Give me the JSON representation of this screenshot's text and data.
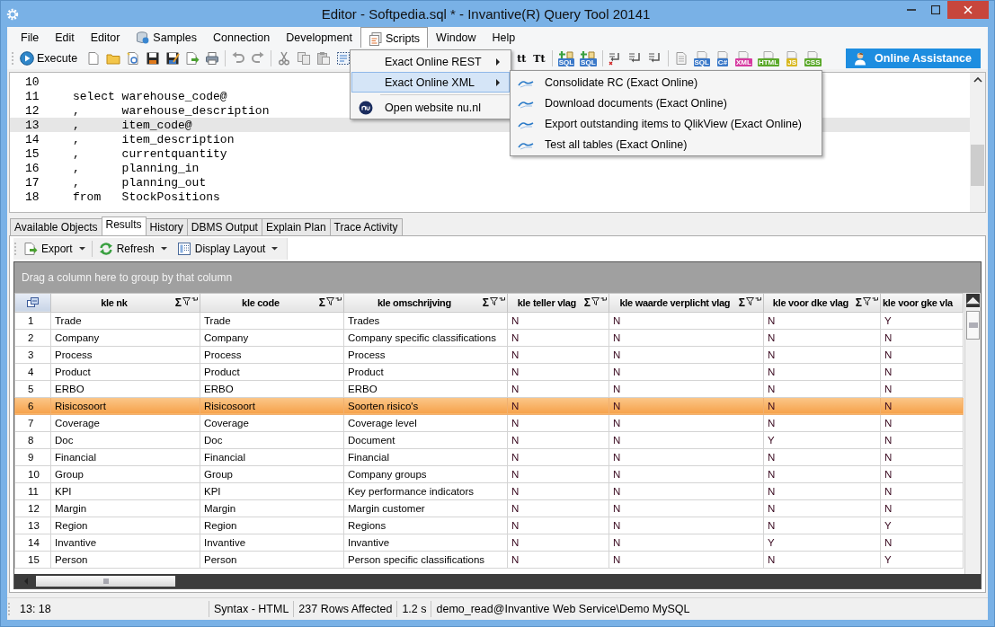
{
  "window": {
    "title": "Editor - Softpedia.sql * - Invantive(R) Query Tool 20141"
  },
  "menubar": [
    {
      "label": "File",
      "kind": "text",
      "selected": false
    },
    {
      "label": "Edit",
      "kind": "text",
      "selected": false
    },
    {
      "label": "Editor",
      "kind": "text",
      "selected": false
    },
    {
      "label": "Samples",
      "kind": "database",
      "selected": false
    },
    {
      "label": "Connection",
      "kind": "text",
      "selected": false
    },
    {
      "label": "Development",
      "kind": "text",
      "selected": false
    },
    {
      "label": "Scripts",
      "kind": "documents",
      "selected": true
    },
    {
      "label": "Window",
      "kind": "text",
      "selected": false
    },
    {
      "label": "Help",
      "kind": "text",
      "selected": false
    }
  ],
  "toolbar": {
    "execute": "Execute",
    "case_buttons": [
      "tt",
      "Tt"
    ],
    "add_script_buttons": [
      "SQL",
      "SQL"
    ],
    "file_type_buttons": [
      {
        "label": "SQL",
        "color": "#3a78c8"
      },
      {
        "label": "C#",
        "color": "#3a78c8"
      },
      {
        "label": "XML",
        "color": "#d63aa0"
      },
      {
        "label": "HTML",
        "color": "#5aa82a"
      },
      {
        "label": "JS",
        "color": "#d8b820"
      },
      {
        "label": "CSS",
        "color": "#5aa82a"
      }
    ],
    "assistance": "Online Assistance"
  },
  "scripts_menu": {
    "items": [
      {
        "label": "Exact Online REST",
        "kind": "submenu",
        "selected": false
      },
      {
        "label": "Exact Online XML",
        "kind": "submenu",
        "selected": true
      },
      {
        "label": "Open website nu.nl",
        "kind": "link",
        "selected": false
      }
    ],
    "submenu": [
      "Consolidate RC (Exact Online)",
      "Download documents (Exact Online)",
      "Export outstanding items to QlikView (Exact Online)",
      "Test all tables (Exact Online)"
    ]
  },
  "editor": {
    "lines": [
      {
        "number": "10",
        "current": false
      },
      {
        "number": "11",
        "text": "select warehouse_code@",
        "current": false
      },
      {
        "number": "12",
        "text": ",      warehouse_description",
        "current": false
      },
      {
        "number": "13",
        "text": ",      item_code@",
        "current": true
      },
      {
        "number": "14",
        "text": ",      item_description",
        "current": false
      },
      {
        "number": "15",
        "text": ",      currentquantity",
        "current": false
      },
      {
        "number": "16",
        "text": ",      planning_in",
        "current": false
      },
      {
        "number": "17",
        "text": ",      planning_out",
        "current": false
      },
      {
        "number": "18",
        "text": "from   StockPositions",
        "current": false
      }
    ]
  },
  "tabs": [
    {
      "label": "Available Objects",
      "selected": false
    },
    {
      "label": "Results",
      "selected": true
    },
    {
      "label": "History",
      "selected": false
    },
    {
      "label": "DBMS Output",
      "selected": false
    },
    {
      "label": "Explain Plan",
      "selected": false
    },
    {
      "label": "Trace Activity",
      "selected": false
    }
  ],
  "results_toolbar": [
    {
      "label": "Export",
      "kind": "export"
    },
    {
      "label": "Refresh",
      "kind": "refresh"
    },
    {
      "label": "Display Layout",
      "kind": "layout"
    }
  ],
  "group_panel": "Drag a column here to group by that column",
  "table": {
    "columns": [
      {
        "label": "kle nk",
        "sum": "Σ"
      },
      {
        "label": "kle code",
        "sum": "Σ"
      },
      {
        "label": "kle omschrijving",
        "sum": "Σ"
      },
      {
        "label": "kle teller vlag",
        "sum": "Σ"
      },
      {
        "label": "kle waarde verplicht vlag",
        "sum": "Σ"
      },
      {
        "label": "kle voor dke vlag",
        "sum": "Σ"
      },
      {
        "label": "kle voor gke vla"
      }
    ],
    "rows": [
      {
        "number": "1",
        "cells": [
          "Trade",
          "Trade",
          "Trades",
          "N",
          "N",
          "N",
          "Y"
        ],
        "selected": false
      },
      {
        "number": "2",
        "cells": [
          "Company",
          "Company",
          "Company specific classifications",
          "N",
          "N",
          "N",
          "N"
        ],
        "selected": false
      },
      {
        "number": "3",
        "cells": [
          "Process",
          "Process",
          "Process",
          "N",
          "N",
          "N",
          "N"
        ],
        "selected": false
      },
      {
        "number": "4",
        "cells": [
          "Product",
          "Product",
          "Product",
          "N",
          "N",
          "N",
          "N"
        ],
        "selected": false
      },
      {
        "number": "5",
        "cells": [
          "ERBO",
          "ERBO",
          "ERBO",
          "N",
          "N",
          "N",
          "N"
        ],
        "selected": false
      },
      {
        "number": "6",
        "cells": [
          "Risicosoort",
          "Risicosoort",
          "Soorten risico's",
          "N",
          "N",
          "N",
          "N"
        ],
        "selected": true
      },
      {
        "number": "7",
        "cells": [
          "Coverage",
          "Coverage",
          "Coverage level",
          "N",
          "N",
          "N",
          "N"
        ],
        "selected": false
      },
      {
        "number": "8",
        "cells": [
          "Doc",
          "Doc",
          "Document",
          "N",
          "N",
          "Y",
          "N"
        ],
        "selected": false
      },
      {
        "number": "9",
        "cells": [
          "Financial",
          "Financial",
          "Financial",
          "N",
          "N",
          "N",
          "N"
        ],
        "selected": false
      },
      {
        "number": "10",
        "cells": [
          "Group",
          "Group",
          "Company groups",
          "N",
          "N",
          "N",
          "N"
        ],
        "selected": false
      },
      {
        "number": "11",
        "cells": [
          "KPI",
          "KPI",
          "Key performance indicators",
          "N",
          "N",
          "N",
          "N"
        ],
        "selected": false
      },
      {
        "number": "12",
        "cells": [
          "Margin",
          "Margin",
          "Margin customer",
          "N",
          "N",
          "N",
          "N"
        ],
        "selected": false
      },
      {
        "number": "13",
        "cells": [
          "Region",
          "Region",
          "Regions",
          "N",
          "N",
          "N",
          "Y"
        ],
        "selected": false
      },
      {
        "number": "14",
        "cells": [
          "Invantive",
          "Invantive",
          "Invantive",
          "N",
          "N",
          "Y",
          "N"
        ],
        "selected": false
      },
      {
        "number": "15",
        "cells": [
          "Person",
          "Person",
          "Person specific classifications",
          "N",
          "N",
          "N",
          "Y"
        ],
        "selected": false
      }
    ]
  },
  "status_bar": [
    "13: 18",
    "Syntax - HTML",
    "237 Rows Affected",
    "1.2 s",
    "demo_read@Invantive Web Service\\Demo MySQL"
  ]
}
